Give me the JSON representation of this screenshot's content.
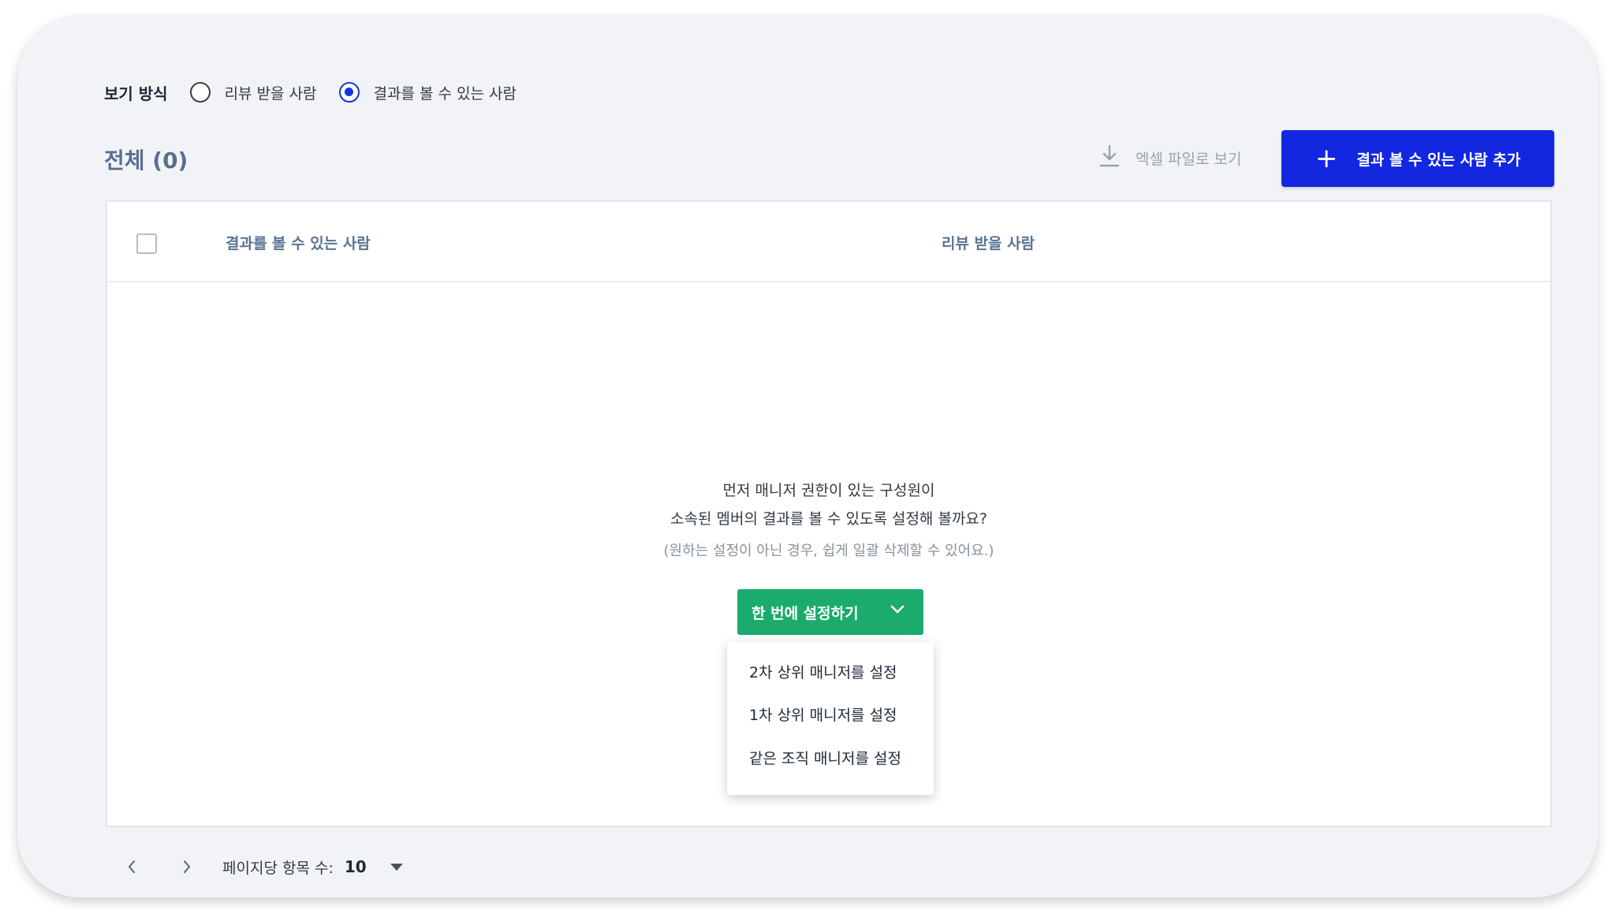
{
  "view_mode": {
    "label": "보기 방식",
    "options": [
      {
        "label": "리뷰 받을 사람",
        "checked": false
      },
      {
        "label": "결과를 볼 수 있는 사람",
        "checked": true
      }
    ]
  },
  "summary": {
    "total_label": "전체 (0)"
  },
  "toolbar": {
    "excel_label": "엑셀 파일로 보기",
    "excel_icon": "download-icon",
    "add_label": "결과 볼 수 있는 사람 추가",
    "add_icon": "plus-icon",
    "add_color": "#1327e0"
  },
  "table": {
    "columns": [
      "결과를 볼 수 있는 사람",
      "리뷰 받을 사람"
    ],
    "rows": []
  },
  "empty_state": {
    "line1": "먼저 매니저 권한이 있는 구성원이",
    "line2": "소속된 멤버의 결과를 볼 수 있도록 설정해 볼까요?",
    "note": "(원하는 설정이 아닌 경우, 쉽게 일괄 삭제할 수 있어요.)",
    "button_label": "한 번에 설정하기",
    "button_icon": "chevron-down-icon",
    "button_color": "#1bab6c",
    "menu": [
      "2차 상위 매니저를 설정",
      "1차 상위 매니저를 설정",
      "같은 조직 매니저를 설정"
    ]
  },
  "pagination": {
    "per_page_label": "페이지당 항목 수:",
    "per_page_value": "10",
    "prev_icon": "chevron-left-icon",
    "next_icon": "chevron-right-icon",
    "dropdown_icon": "caret-down-icon"
  }
}
